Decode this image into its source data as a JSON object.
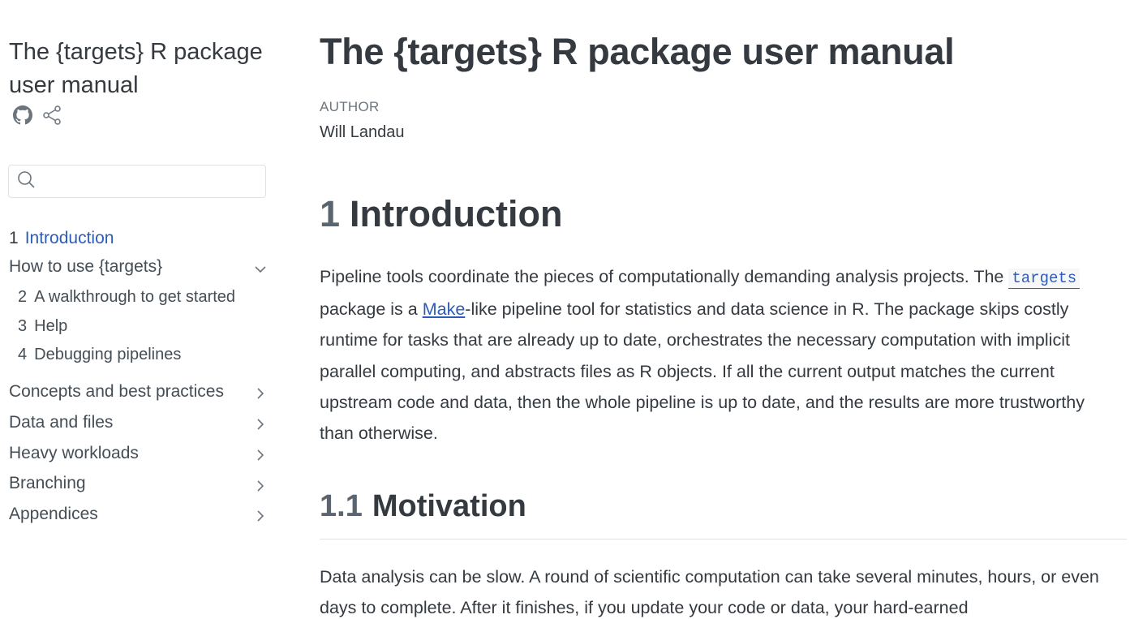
{
  "sidebar": {
    "title": "The {targets} R package user manual",
    "search": {
      "placeholder": "",
      "value": ""
    },
    "icons": {
      "github": "github-icon",
      "share": "share-icon",
      "search": "search-icon",
      "chevron": "chevron-icon"
    },
    "nav": {
      "intro": {
        "num": "1",
        "label": "Introduction"
      },
      "how_to": {
        "label": "How to use {targets}"
      },
      "how_to_items": [
        {
          "num": "2",
          "label": "A walkthrough to get started"
        },
        {
          "num": "3",
          "label": "Help"
        },
        {
          "num": "4",
          "label": "Debugging pipelines"
        }
      ],
      "sections": [
        {
          "label": "Concepts and best practices"
        },
        {
          "label": "Data and files"
        },
        {
          "label": "Heavy workloads"
        },
        {
          "label": "Branching"
        },
        {
          "label": "Appendices"
        }
      ]
    }
  },
  "main": {
    "title": "The {targets} R package user manual",
    "author_label": "AUTHOR",
    "author": "Will Landau",
    "section1": {
      "num": "1",
      "title": "Introduction"
    },
    "intro_paragraph": {
      "before_code": "Pipeline tools coordinate the pieces of computationally demanding analysis projects. The ",
      "code": "targets",
      "between": " package is a ",
      "link": "Make",
      "after": "-like pipeline tool for statistics and data science in R. The package skips costly runtime for tasks that are already up to date, orchestrates the necessary computation with implicit parallel computing, and abstracts files as R objects. If all the current output matches the current upstream code and data, then the whole pipeline is up to date, and the results are more trustworthy than otherwise."
    },
    "section11": {
      "num": "1.1",
      "title": "Motivation"
    },
    "motivation_paragraph": "Data analysis can be slow. A round of scientific computation can take several minutes, hours, or even days to complete. After it finishes, if you update your code or data, your hard-earned"
  },
  "colors": {
    "link": "#2d5cb8",
    "text": "#343a40",
    "muted": "#6c757d",
    "border": "#dee2e6"
  }
}
